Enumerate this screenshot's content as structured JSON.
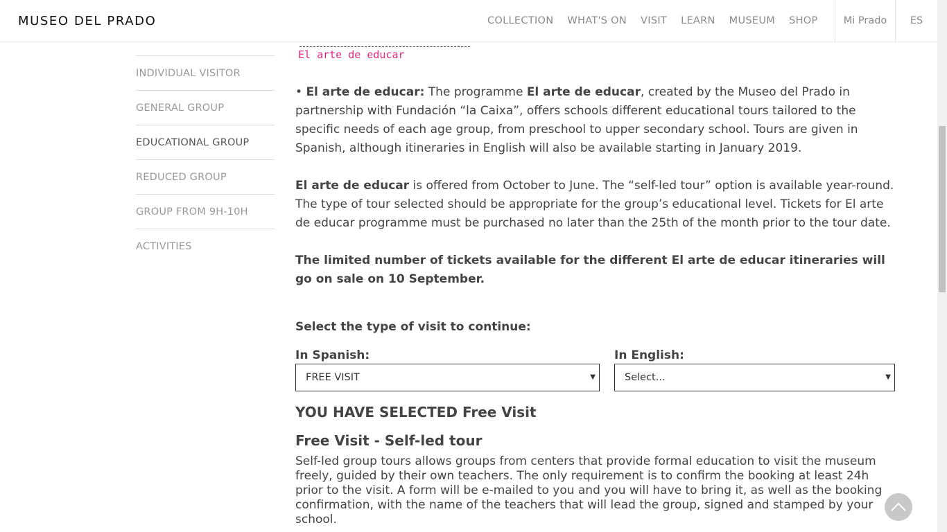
{
  "header": {
    "logo": "MUSEO DEL PRADO",
    "nav": [
      "COLLECTION",
      "WHAT'S ON",
      "VISIT",
      "LEARN",
      "MUSEUM",
      "SHOP"
    ],
    "mi_prado": "Mi Prado",
    "lang": "ES"
  },
  "sidebar": {
    "items": [
      {
        "label": "INDIVIDUAL VISITOR"
      },
      {
        "label": "GENERAL GROUP"
      },
      {
        "label": "EDUCATIONAL GROUP"
      },
      {
        "label": "REDUCED GROUP"
      },
      {
        "label": "GROUP FROM 9H-10H"
      },
      {
        "label": "ACTIVITIES"
      }
    ],
    "active_index": 2
  },
  "main": {
    "logo_name": "El arte de educar",
    "p1": {
      "bullet": "• ",
      "b1": "El arte de educar:",
      "t1": " The programme ",
      "b2": "El arte de educar",
      "t2": ", created by the Museo del Prado in partnership with Fundación “la Caixa”, offers schools different educational tours tailored to the specific needs of each age group, from preschool to upper secondary school. Tours are given in Spanish, although itineraries in English will also be available starting in January 2019."
    },
    "p2": {
      "b1": "El arte de educar",
      "t1": " is offered from October to June. The “self-led tour” option is available year-round. The type of tour selected should be appropriate for the group’s educational level. Tickets for El arte de educar programme must be purchased no later than the 25th of the month prior to the tour date."
    },
    "p3": "The limited number of tickets available for the different El arte de educar itineraries will go on sale on 10 September.",
    "select_title": "Select the type of visit to continue:",
    "label_spanish": "In Spanish:",
    "label_english": "In English:",
    "select_spanish_value": "FREE VISIT",
    "select_english_value": "Select...",
    "selected_heading": "YOU HAVE SELECTED Free Visit",
    "visit_heading": "Free Visit - Self-led tour",
    "p4": "Self-led group tours allows groups from centers that provide formal education to visit the museum freely, guided by their own teachers. The only requirement is to confirm the booking at least 24h prior to the visit. A form will be e-mailed to you and you will have to bring it, as well as the booking confirmation, with the name of the teachers that will lead the group, signed and stamped by your school."
  },
  "icons": {
    "select_caret": "caret-down-icon",
    "back_to_top": "chevron-up-icon"
  },
  "colors": {
    "logo_pink": "#e0287f",
    "text": "#444444",
    "nav_text": "#8a8a8a"
  }
}
